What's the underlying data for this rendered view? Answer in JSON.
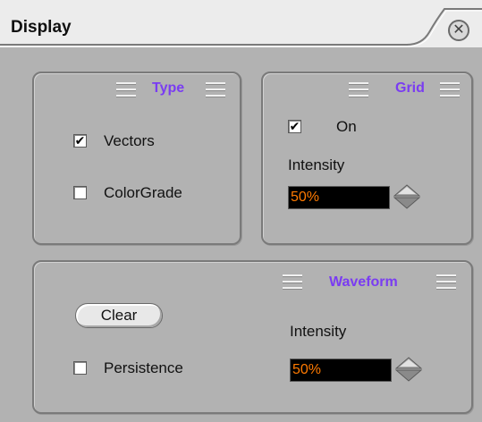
{
  "window": {
    "title": "Display"
  },
  "type_panel": {
    "title": "Type",
    "vectors": {
      "label": "Vectors",
      "checked": true
    },
    "colorgrade": {
      "label": "ColorGrade",
      "checked": false
    }
  },
  "grid_panel": {
    "title": "Grid",
    "on": {
      "label": "On",
      "checked": true
    },
    "intensity_label": "Intensity",
    "intensity_value": "50%"
  },
  "waveform_panel": {
    "title": "Waveform",
    "clear_label": "Clear",
    "persistence": {
      "label": "Persistence",
      "checked": false
    },
    "intensity_label": "Intensity",
    "intensity_value": "50%"
  },
  "checkmark": "✔",
  "close_glyph": "✕",
  "colors": {
    "accent": "#7a3cf2",
    "value_text": "#ff7a00",
    "panel_bg": "#b2b2b2"
  }
}
